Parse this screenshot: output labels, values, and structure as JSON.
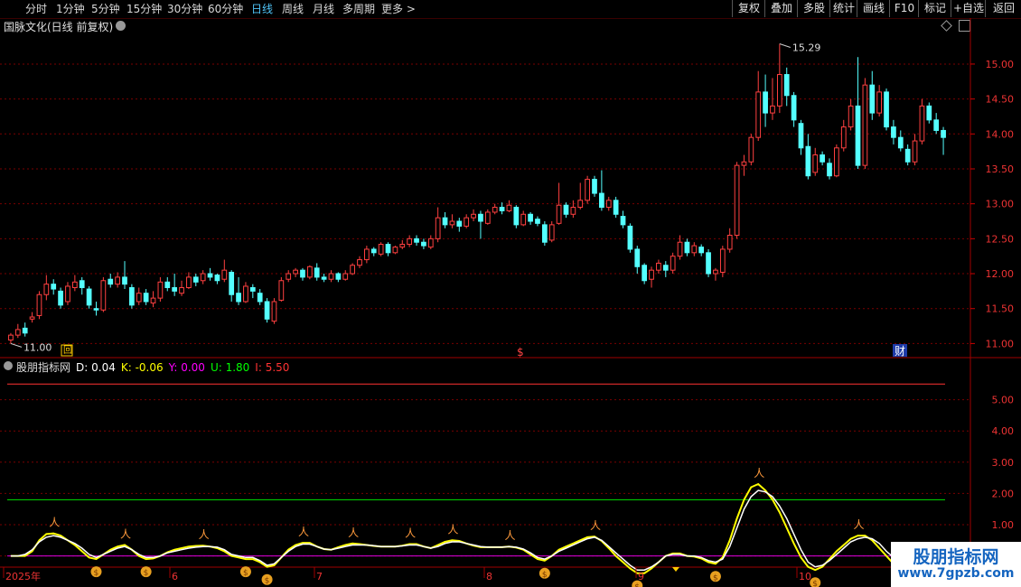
{
  "toolbar": {
    "left": [
      "分时",
      "1分钟",
      "5分钟",
      "15分钟",
      "30分钟",
      "60分钟",
      "日线",
      "周线",
      "月线",
      "多周期",
      "更多 >"
    ],
    "active": "日线",
    "right": [
      "复权",
      "叠加",
      "多股",
      "统计",
      "画线",
      "F10",
      "标记",
      "+自选",
      "返回"
    ]
  },
  "stock_title": "国脉文化(日线 前复权)",
  "price_axis": [
    "15.00",
    "14.50",
    "14.00",
    "13.50",
    "13.00",
    "12.50",
    "12.00",
    "11.50",
    "11.00"
  ],
  "high_label": "15.29",
  "low_label": "11.00",
  "markers": {
    "box": "回",
    "dollar": "$",
    "cai": "财"
  },
  "indicator": {
    "name": "股朋指标网",
    "d": "D: 0.04",
    "k": "K: -0.06",
    "y": "Y: 0.00",
    "u": "U: 1.80",
    "i": "I: 5.50",
    "colors": {
      "d": "#ffffff",
      "k": "#ffff00",
      "y": "#ff00ff",
      "u": "#00ff00",
      "i": "#ff3333"
    }
  },
  "ind_axis": [
    "5.00",
    "4.00",
    "3.00",
    "2.00",
    "1.00",
    "0.00"
  ],
  "months": [
    "2025年",
    "6",
    "7",
    "8",
    "9",
    "10"
  ],
  "watermark": {
    "line1": "股朋指标网",
    "line2": "www.7gpzb.com"
  },
  "chart_data": {
    "type": "candlestick",
    "title": "国脉文化(日线 前复权)",
    "ylim": [
      10.85,
      15.4
    ],
    "candles": [
      [
        11.05,
        11.12,
        11.0,
        11.15
      ],
      [
        11.12,
        11.2,
        11.08,
        11.28
      ],
      [
        11.22,
        11.15,
        11.1,
        11.3
      ],
      [
        11.35,
        11.38,
        11.3,
        11.45
      ],
      [
        11.4,
        11.7,
        11.35,
        11.75
      ],
      [
        11.7,
        11.85,
        11.62,
        11.98
      ],
      [
        11.85,
        11.78,
        11.7,
        11.92
      ],
      [
        11.75,
        11.55,
        11.5,
        11.8
      ],
      [
        11.6,
        11.82,
        11.55,
        11.88
      ],
      [
        11.8,
        11.88,
        11.75,
        11.98
      ],
      [
        11.9,
        11.8,
        11.7,
        11.95
      ],
      [
        11.78,
        11.55,
        11.5,
        11.82
      ],
      [
        11.5,
        11.48,
        11.4,
        11.6
      ],
      [
        11.48,
        11.9,
        11.45,
        11.95
      ],
      [
        11.92,
        11.85,
        11.8,
        12.0
      ],
      [
        11.85,
        11.95,
        11.8,
        12.02
      ],
      [
        11.95,
        11.85,
        11.78,
        12.18
      ],
      [
        11.8,
        11.55,
        11.5,
        11.85
      ],
      [
        11.6,
        11.72,
        11.55,
        11.8
      ],
      [
        11.72,
        11.6,
        11.55,
        11.78
      ],
      [
        11.58,
        11.65,
        11.52,
        11.75
      ],
      [
        11.65,
        11.88,
        11.6,
        11.95
      ],
      [
        11.88,
        11.8,
        11.75,
        11.95
      ],
      [
        11.8,
        11.75,
        11.68,
        12.0
      ],
      [
        11.72,
        11.8,
        11.68,
        11.9
      ],
      [
        11.8,
        11.95,
        11.78,
        12.02
      ],
      [
        11.95,
        11.88,
        11.82,
        12.0
      ],
      [
        11.9,
        12.0,
        11.85,
        12.05
      ],
      [
        12.0,
        11.95,
        11.9,
        12.08
      ],
      [
        11.98,
        11.9,
        11.85,
        12.0
      ],
      [
        11.92,
        12.05,
        11.88,
        12.2
      ],
      [
        12.02,
        11.7,
        11.6,
        12.05
      ],
      [
        11.72,
        11.6,
        11.55,
        11.95
      ],
      [
        11.6,
        11.82,
        11.58,
        11.88
      ],
      [
        11.8,
        11.75,
        11.65,
        11.85
      ],
      [
        11.72,
        11.6,
        11.55,
        11.78
      ],
      [
        11.6,
        11.35,
        11.3,
        11.65
      ],
      [
        11.32,
        11.6,
        11.28,
        11.65
      ],
      [
        11.62,
        11.9,
        11.6,
        11.95
      ],
      [
        11.92,
        12.0,
        11.88,
        12.05
      ],
      [
        12.0,
        12.05,
        11.95,
        12.08
      ],
      [
        12.05,
        11.95,
        11.9,
        12.08
      ],
      [
        11.95,
        12.1,
        11.92,
        12.12
      ],
      [
        12.08,
        11.95,
        11.9,
        12.15
      ],
      [
        11.95,
        11.92,
        11.88,
        12.0
      ],
      [
        11.92,
        12.0,
        11.88,
        12.05
      ],
      [
        12.0,
        11.92,
        11.88,
        12.02
      ],
      [
        11.92,
        12.0,
        11.9,
        12.05
      ],
      [
        12.0,
        12.12,
        11.98,
        12.15
      ],
      [
        12.12,
        12.2,
        12.08,
        12.25
      ],
      [
        12.2,
        12.35,
        12.15,
        12.4
      ],
      [
        12.35,
        12.3,
        12.25,
        12.38
      ],
      [
        12.28,
        12.42,
        12.25,
        12.45
      ],
      [
        12.42,
        12.3,
        12.25,
        12.45
      ],
      [
        12.3,
        12.38,
        12.28,
        12.4
      ],
      [
        12.38,
        12.42,
        12.35,
        12.48
      ],
      [
        12.42,
        12.5,
        12.38,
        12.55
      ],
      [
        12.5,
        12.45,
        12.4,
        12.55
      ],
      [
        12.45,
        12.4,
        12.35,
        12.5
      ],
      [
        12.38,
        12.5,
        12.35,
        12.55
      ],
      [
        12.5,
        12.8,
        12.45,
        12.95
      ],
      [
        12.8,
        12.7,
        12.65,
        12.88
      ],
      [
        12.7,
        12.75,
        12.65,
        12.85
      ],
      [
        12.75,
        12.68,
        12.6,
        12.8
      ],
      [
        12.68,
        12.8,
        12.65,
        12.85
      ],
      [
        12.8,
        12.85,
        12.75,
        12.92
      ],
      [
        12.85,
        12.75,
        12.5,
        12.9
      ],
      [
        12.72,
        12.88,
        12.7,
        12.92
      ],
      [
        12.88,
        12.95,
        12.85,
        13.0
      ],
      [
        12.95,
        12.9,
        12.85,
        13.02
      ],
      [
        12.9,
        12.98,
        12.88,
        13.05
      ],
      [
        12.95,
        12.7,
        12.65,
        12.98
      ],
      [
        12.7,
        12.85,
        12.68,
        12.9
      ],
      [
        12.85,
        12.75,
        12.7,
        12.88
      ],
      [
        12.78,
        12.72,
        12.68,
        12.82
      ],
      [
        12.7,
        12.45,
        12.4,
        12.75
      ],
      [
        12.48,
        12.7,
        12.45,
        12.75
      ],
      [
        12.72,
        12.98,
        12.7,
        13.3
      ],
      [
        12.98,
        12.85,
        12.8,
        13.02
      ],
      [
        12.85,
        12.95,
        12.8,
        13.05
      ],
      [
        12.95,
        13.05,
        12.92,
        13.3
      ],
      [
        13.05,
        13.35,
        13.0,
        13.4
      ],
      [
        13.35,
        13.15,
        13.1,
        13.4
      ],
      [
        13.15,
        12.95,
        12.9,
        13.48
      ],
      [
        12.95,
        13.05,
        12.9,
        13.1
      ],
      [
        13.05,
        12.85,
        12.8,
        13.1
      ],
      [
        12.82,
        12.7,
        12.65,
        12.9
      ],
      [
        12.68,
        12.35,
        12.3,
        12.72
      ],
      [
        12.35,
        12.1,
        12.0,
        12.4
      ],
      [
        12.12,
        11.9,
        11.85,
        12.15
      ],
      [
        11.92,
        12.05,
        11.8,
        12.1
      ],
      [
        12.05,
        12.15,
        12.0,
        12.2
      ],
      [
        12.12,
        12.05,
        11.95,
        12.18
      ],
      [
        12.05,
        12.25,
        12.0,
        12.3
      ],
      [
        12.25,
        12.45,
        12.2,
        12.55
      ],
      [
        12.45,
        12.3,
        12.25,
        12.5
      ],
      [
        12.3,
        12.4,
        12.25,
        12.45
      ],
      [
        12.38,
        12.3,
        12.25,
        12.42
      ],
      [
        12.3,
        12.0,
        11.95,
        12.35
      ],
      [
        12.0,
        12.05,
        11.9,
        12.08
      ],
      [
        12.02,
        12.35,
        11.95,
        12.4
      ],
      [
        12.35,
        12.55,
        12.3,
        12.65
      ],
      [
        12.55,
        13.55,
        12.5,
        13.6
      ],
      [
        13.55,
        13.6,
        13.4,
        13.7
      ],
      [
        13.6,
        13.95,
        13.55,
        14.0
      ],
      [
        13.95,
        14.6,
        13.9,
        14.9
      ],
      [
        14.6,
        14.3,
        14.1,
        14.85
      ],
      [
        14.3,
        14.4,
        14.2,
        14.8
      ],
      [
        14.4,
        14.85,
        14.3,
        15.29
      ],
      [
        14.85,
        14.55,
        14.4,
        14.95
      ],
      [
        14.55,
        14.2,
        14.1,
        14.6
      ],
      [
        14.15,
        13.8,
        13.7,
        14.2
      ],
      [
        13.82,
        13.4,
        13.35,
        14.0
      ],
      [
        13.45,
        13.7,
        13.4,
        13.8
      ],
      [
        13.7,
        13.6,
        13.55,
        13.75
      ],
      [
        13.58,
        13.4,
        13.35,
        13.65
      ],
      [
        13.4,
        13.8,
        13.38,
        13.85
      ],
      [
        13.8,
        14.1,
        13.75,
        14.2
      ],
      [
        14.1,
        14.4,
        14.05,
        14.5
      ],
      [
        14.4,
        13.55,
        13.5,
        15.1
      ],
      [
        13.55,
        14.7,
        13.5,
        14.8
      ],
      [
        14.7,
        14.3,
        14.2,
        14.9
      ],
      [
        14.3,
        14.6,
        14.25,
        14.7
      ],
      [
        14.6,
        14.1,
        14.05,
        14.65
      ],
      [
        14.1,
        13.95,
        13.85,
        14.2
      ],
      [
        13.95,
        13.8,
        13.75,
        14.05
      ],
      [
        13.78,
        13.6,
        13.55,
        13.85
      ],
      [
        13.6,
        13.9,
        13.55,
        14.0
      ],
      [
        13.9,
        14.4,
        13.85,
        14.5
      ],
      [
        14.4,
        14.2,
        14.15,
        14.45
      ],
      [
        14.2,
        14.05,
        14.0,
        14.3
      ],
      [
        14.05,
        13.95,
        13.7,
        14.1
      ]
    ],
    "indicator": {
      "ylim": [
        -0.3,
        6.0
      ],
      "D": [
        0.0,
        0.0,
        0.05,
        0.2,
        0.45,
        0.6,
        0.65,
        0.6,
        0.5,
        0.4,
        0.25,
        0.05,
        -0.05,
        0.05,
        0.15,
        0.25,
        0.3,
        0.2,
        0.05,
        -0.05,
        -0.05,
        0.0,
        0.1,
        0.15,
        0.2,
        0.25,
        0.28,
        0.3,
        0.3,
        0.28,
        0.2,
        0.05,
        0.0,
        -0.05,
        -0.05,
        -0.15,
        -0.3,
        -0.25,
        -0.05,
        0.15,
        0.3,
        0.38,
        0.38,
        0.3,
        0.22,
        0.2,
        0.25,
        0.3,
        0.35,
        0.35,
        0.35,
        0.33,
        0.3,
        0.3,
        0.3,
        0.32,
        0.35,
        0.35,
        0.3,
        0.25,
        0.3,
        0.4,
        0.45,
        0.45,
        0.4,
        0.35,
        0.3,
        0.28,
        0.28,
        0.28,
        0.3,
        0.28,
        0.22,
        0.1,
        -0.05,
        -0.1,
        0.0,
        0.15,
        0.25,
        0.35,
        0.45,
        0.55,
        0.6,
        0.5,
        0.3,
        0.1,
        -0.1,
        -0.3,
        -0.45,
        -0.45,
        -0.35,
        -0.2,
        0.0,
        0.05,
        0.05,
        0.0,
        0.0,
        -0.05,
        -0.15,
        -0.2,
        -0.1,
        0.3,
        0.9,
        1.5,
        1.9,
        2.1,
        2.05,
        1.9,
        1.6,
        1.2,
        0.7,
        0.2,
        -0.2,
        -0.35,
        -0.3,
        -0.15,
        0.05,
        0.25,
        0.45,
        0.55,
        0.6,
        0.55,
        0.4,
        0.15,
        -0.05,
        -0.15,
        -0.15,
        -0.05,
        0.02,
        0.05,
        0.05,
        0.04
      ],
      "K": [
        0.0,
        0.0,
        0.0,
        0.15,
        0.5,
        0.7,
        0.72,
        0.65,
        0.5,
        0.35,
        0.15,
        -0.05,
        -0.1,
        0.05,
        0.2,
        0.3,
        0.35,
        0.2,
        0.0,
        -0.1,
        -0.08,
        0.0,
        0.12,
        0.2,
        0.25,
        0.3,
        0.32,
        0.33,
        0.3,
        0.25,
        0.15,
        0.0,
        -0.05,
        -0.1,
        -0.1,
        -0.2,
        -0.35,
        -0.3,
        -0.05,
        0.2,
        0.35,
        0.42,
        0.42,
        0.3,
        0.22,
        0.2,
        0.28,
        0.35,
        0.4,
        0.38,
        0.35,
        0.32,
        0.3,
        0.3,
        0.3,
        0.33,
        0.38,
        0.38,
        0.3,
        0.25,
        0.35,
        0.45,
        0.5,
        0.48,
        0.4,
        0.33,
        0.28,
        0.28,
        0.28,
        0.28,
        0.3,
        0.27,
        0.2,
        0.05,
        -0.1,
        -0.15,
        0.0,
        0.2,
        0.3,
        0.4,
        0.5,
        0.6,
        0.62,
        0.48,
        0.25,
        0.0,
        -0.2,
        -0.4,
        -0.55,
        -0.55,
        -0.4,
        -0.2,
        0.0,
        0.08,
        0.08,
        0.0,
        -0.02,
        -0.08,
        -0.2,
        -0.25,
        -0.05,
        0.5,
        1.2,
        1.8,
        2.2,
        2.3,
        2.1,
        1.8,
        1.4,
        0.9,
        0.4,
        -0.05,
        -0.35,
        -0.45,
        -0.35,
        -0.1,
        0.15,
        0.35,
        0.55,
        0.65,
        0.65,
        0.5,
        0.25,
        0.0,
        -0.25,
        -0.35,
        -0.25,
        -0.1,
        0.0,
        0.05,
        0.02,
        -0.06
      ],
      "Y": 0.0,
      "U": 1.8,
      "I": 5.5
    }
  }
}
